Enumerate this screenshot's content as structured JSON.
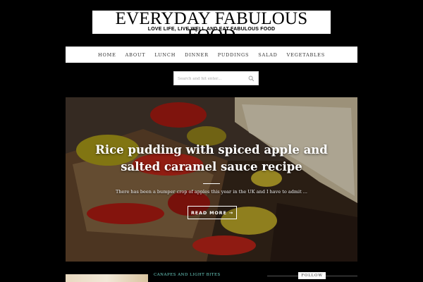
{
  "header": {
    "title": "EVERYDAY FABULOUS FOOD",
    "tagline": "LOVE LIFE, LIVE WELL AND EAT FABULOUS FOOD"
  },
  "nav": {
    "items": [
      "HOME",
      "ABOUT",
      "LUNCH",
      "DINNER",
      "PUDDINGS",
      "SALAD",
      "VEGETABLES"
    ]
  },
  "search": {
    "placeholder": "Search and hit enter..."
  },
  "hero": {
    "title": "Rice pudding with spiced apple and salted caramel sauce recipe",
    "excerpt": "There has been a bumper crop of apples this year in the UK and I have to admit ...",
    "read_more": "READ MORE →"
  },
  "below": {
    "category": "CANAPES AND LIGHT BITES",
    "follow": "FOLLOW"
  },
  "colors": {
    "background": "#000000",
    "accent": "#6fd4c8"
  }
}
